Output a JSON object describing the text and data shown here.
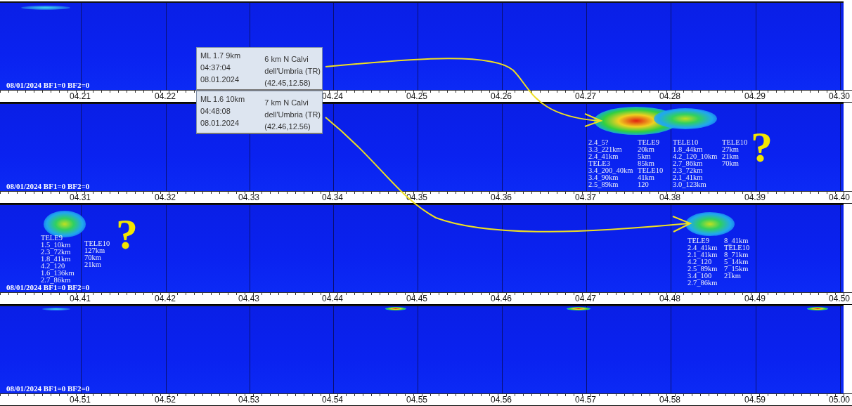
{
  "strips": [
    {
      "caption": "08/01/2024 BF1=0 BF2=0",
      "ticks": [
        "04.21",
        "04.22",
        "04.24",
        "04.25",
        "04.26",
        "04.27",
        "04.28",
        "04.29",
        "04.30"
      ]
    },
    {
      "caption": "08/01/2024 BF1=0 BF2=0",
      "ticks": [
        "04.31",
        "04.32",
        "04.33",
        "04.34",
        "04.35",
        "04.36",
        "04.37",
        "04.38",
        "04.39",
        "04.40"
      ],
      "annotation": "?",
      "label_groups": [
        {
          "lines": [
            "2.4_5?",
            "3.3_221km",
            "2.4_41km",
            "TELE3",
            "3.4_200_40km",
            "3.4_90km",
            "2.5_89km"
          ]
        },
        {
          "lines": [
            "TELE9",
            "20km",
            "5km",
            "85km",
            "TELE10",
            "41km",
            "120"
          ]
        },
        {
          "lines": [
            "TELE10",
            "1.8_44km",
            "4.2_120_10km",
            "2.7_86km",
            "2.3_72km",
            "2.1_41km",
            "3.0_123km"
          ]
        },
        {
          "lines": [
            "TELE10",
            "27km",
            "21km",
            "70km"
          ]
        }
      ]
    },
    {
      "caption": "08/01/2024 BF1=0 BF2=0",
      "ticks": [
        "04.41",
        "04.42",
        "04.43",
        "04.44",
        "04.45",
        "04.46",
        "04.47",
        "04.48",
        "04.49",
        "04.50"
      ],
      "annotation": "?",
      "label_groups": [
        {
          "lines": [
            "TELE9",
            "1.5_10km",
            "2.3_72km",
            "1.8_41km",
            "4.2_120",
            "1.6_136km",
            "2.7_86km"
          ]
        },
        {
          "lines": [
            "TELE10",
            "127km",
            "70km",
            "21km"
          ]
        },
        {
          "lines": [
            "TELE9",
            "2.4_41km",
            "2.1_41km",
            "4.2_120",
            "2.5_89km",
            "3.4_100",
            "2.7_86km"
          ]
        },
        {
          "lines": [
            "8_41km",
            "TELE10",
            "8_71km",
            "5_14km",
            "7_15km",
            "21km"
          ]
        }
      ]
    },
    {
      "caption": "08/01/2024 BF1=0 BF2=0",
      "ticks": [
        "04.51",
        "04.52",
        "04.53",
        "04.54",
        "04.55",
        "04.56",
        "04.57",
        "04.58",
        "04.59",
        "05.00"
      ]
    }
  ],
  "event_popups": [
    {
      "magnitude_depth": "ML 1.7 9km",
      "time": "04:37:04",
      "date": "08.01.2024",
      "place": "6 km N Calvi",
      "region": "dell'Umbria (TR)",
      "coords": "(42.45,12.58)"
    },
    {
      "magnitude_depth": "ML 1.6 10km",
      "time": "04:48:08",
      "date": "08.01.2024",
      "place": "7 km N Calvi",
      "region": "dell'Umbria (TR)",
      "coords": "(42.46,12.56)"
    }
  ]
}
